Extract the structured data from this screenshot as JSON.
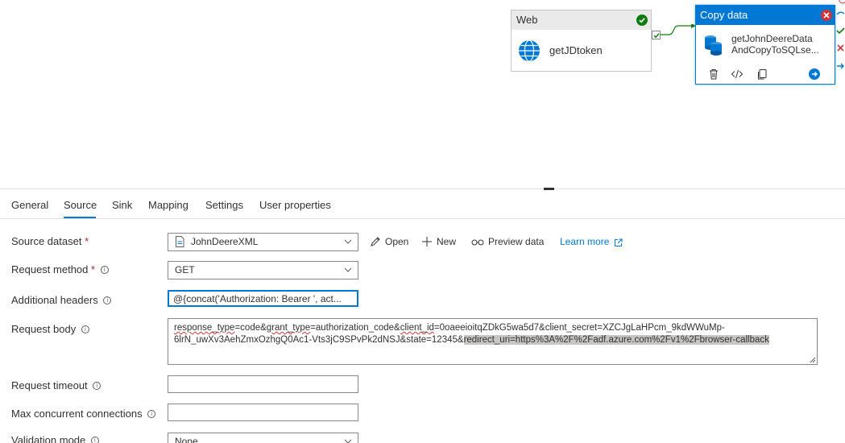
{
  "canvas": {
    "web_activity": {
      "type_label": "Web",
      "name": "getJDtoken"
    },
    "copy_activity": {
      "type_label": "Copy data",
      "name_line1": "getJohnDeereData",
      "name_line2": "AndCopyToSQLse..."
    }
  },
  "tabs": [
    {
      "label": "General"
    },
    {
      "label": "Source"
    },
    {
      "label": "Sink"
    },
    {
      "label": "Mapping"
    },
    {
      "label": "Settings"
    },
    {
      "label": "User properties"
    }
  ],
  "active_tab": "Source",
  "form": {
    "source_dataset": {
      "label": "Source dataset",
      "required_mark": "*",
      "value": "JohnDeereXML"
    },
    "dataset_actions": {
      "open": "Open",
      "new": "New",
      "preview": "Preview data",
      "learn_more": "Learn more"
    },
    "request_method": {
      "label": "Request method",
      "required_mark": "*",
      "value": "GET"
    },
    "additional_headers": {
      "label": "Additional headers",
      "value": "@{concat('Authorization: Bearer ', act..."
    },
    "request_body": {
      "label": "Request body",
      "seg1": "response_type",
      "seg2": "=code&",
      "seg3": "grant_type",
      "seg4": "=authorization_code&",
      "seg5": "client_id",
      "seg6": "=0oaeeioitqZDkG5wa5d7&client_secret=XZCJgLaHPcm_9kdWWuMp-",
      "line2a": "6lrN_uwXv3AehZmxOzhgQ0Ac1-Vts3jC9SPvPk2dNSJ&state=12345&",
      "line2b": "redirect_uri=https%3A%2F%2Fadf.azure.com%2Fv1%2Fbrowser-callback"
    },
    "request_timeout": {
      "label": "Request timeout",
      "value": ""
    },
    "max_concurrent": {
      "label": "Max concurrent connections",
      "value": ""
    },
    "validation_mode": {
      "label": "Validation mode",
      "value": "None"
    }
  },
  "colors": {
    "accent": "#0078d4",
    "success": "#107c10",
    "error": "#d13438"
  }
}
